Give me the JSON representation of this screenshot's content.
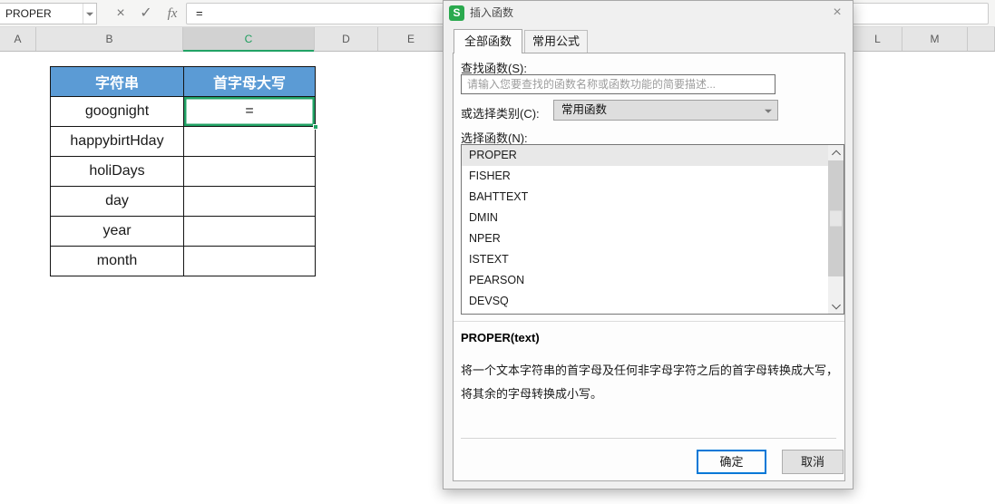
{
  "formula_bar": {
    "name_box_value": "PROPER",
    "cancel_icon": "×",
    "confirm_icon": "✓",
    "fx_icon": "fx",
    "formula_value": "="
  },
  "column_headers": {
    "labels": [
      "A",
      "B",
      "C",
      "D",
      "E",
      "L",
      "M"
    ],
    "selected": "C"
  },
  "table": {
    "headers": [
      "字符串",
      "首字母大写"
    ],
    "rows": [
      [
        "goognight",
        "="
      ],
      [
        "happybirtHday",
        ""
      ],
      [
        "holiDays",
        ""
      ],
      [
        "day",
        ""
      ],
      [
        "year",
        ""
      ],
      [
        "month",
        ""
      ]
    ],
    "selection": {
      "row": 0,
      "col": 1
    },
    "header_bg": "#5b9bd5"
  },
  "dialog": {
    "logo_letter": "S",
    "title": "插入函数",
    "close_icon": "×",
    "tabs": [
      {
        "label": "全部函数",
        "active": true
      },
      {
        "label": "常用公式",
        "active": false
      }
    ],
    "search_label": "查找函数(S):",
    "search_placeholder": "请输入您要查找的函数名称或函数功能的简要描述...",
    "category_label": "或选择类别(C):",
    "category_value": "常用函数",
    "select_label": "选择函数(N):",
    "function_list": {
      "items": [
        "PROPER",
        "FISHER",
        "BAHTTEXT",
        "DMIN",
        "NPER",
        "ISTEXT",
        "PEARSON",
        "DEVSQ"
      ],
      "selected": "PROPER"
    },
    "signature": "PROPER(text)",
    "description": "将一个文本字符串的首字母及任何非字母字符之后的首字母转换成大写，将其余的字母转换成小写。",
    "ok_label": "确定",
    "cancel_label": "取消"
  },
  "colors": {
    "table_header_blue": "#5b9bd5",
    "selection_green": "#21a265",
    "wps_logo_green": "#2aa94e",
    "ok_button_border_blue": "#0078d7"
  }
}
